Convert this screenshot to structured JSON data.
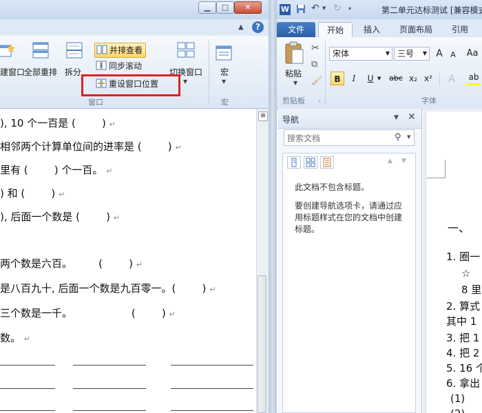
{
  "left_window": {
    "caption_buttons": {
      "minimize": "▁",
      "maximize": "□",
      "close": "✕"
    },
    "ribbon": {
      "new_window_partial": "建窗口",
      "arrange_all": "全部重排",
      "split": "拆分",
      "view_side_by_side": "并排查看",
      "sync_scrolling": "同步滚动",
      "reset_window_position": "重设窗口位置",
      "switch_windows": "切换窗口",
      "macros": "宏",
      "group_window": "窗口",
      "group_macros": "宏"
    },
    "doc_lines": [
      {
        "text": "), 10 个一百是 (        )",
        "mark": "↵"
      },
      {
        "text": "相邻两个计算单位间的进率是 (        )",
        "mark": "↵"
      },
      {
        "text": "里有 (        ) 个一百。",
        "mark": "↵"
      },
      {
        "text": ") 和 (        )",
        "mark": "↵"
      },
      {
        "text": "), 后面一个数是 (        )",
        "mark": "↵"
      },
      {
        "text": "",
        "mark": ""
      },
      {
        "text": "两个数是六百。        (        )",
        "mark": "↵"
      },
      {
        "text": "是八百九十, 后面一个数是九百零一。(        )",
        "mark": "↵"
      },
      {
        "text": "三个数是一千。                  (        )",
        "mark": "↵"
      },
      {
        "text": "数。",
        "mark": "↵"
      }
    ]
  },
  "right_window": {
    "title": "第二单元达标测试 [兼容模式",
    "tabs": [
      "文件",
      "开始",
      "插入",
      "页面布局",
      "引用"
    ],
    "ribbon": {
      "paste": "粘贴",
      "clipboard_group": "剪贴板",
      "font_name": "宋体",
      "font_size": "三号",
      "grow_font": "A",
      "shrink_font": "A",
      "bold": "B",
      "italic": "I",
      "underline": "U",
      "strikethrough": "abc",
      "subscript": "x₂",
      "superscript": "x²",
      "font_group": "字体"
    },
    "nav_pane": {
      "title": "导航",
      "search_placeholder": "搜索文档",
      "message_1": "此文档不包含标题。",
      "message_2": "要创建导航选项卡，请通过应用标题样式在您的文档中创建标题。"
    },
    "doc_lines": [
      "一、",
      "1. 圈一",
      "☆",
      "8 里",
      "2. 算式",
      "其中 1",
      "3. 把 1",
      "4. 把 2",
      "5. 16 个",
      "6. 拿出",
      "(1)",
      "(2)"
    ]
  },
  "colors": {
    "accent_blue": "#2a5da6",
    "highlight_red": "#e02020",
    "ribbon_bg": "#dce7f4"
  }
}
